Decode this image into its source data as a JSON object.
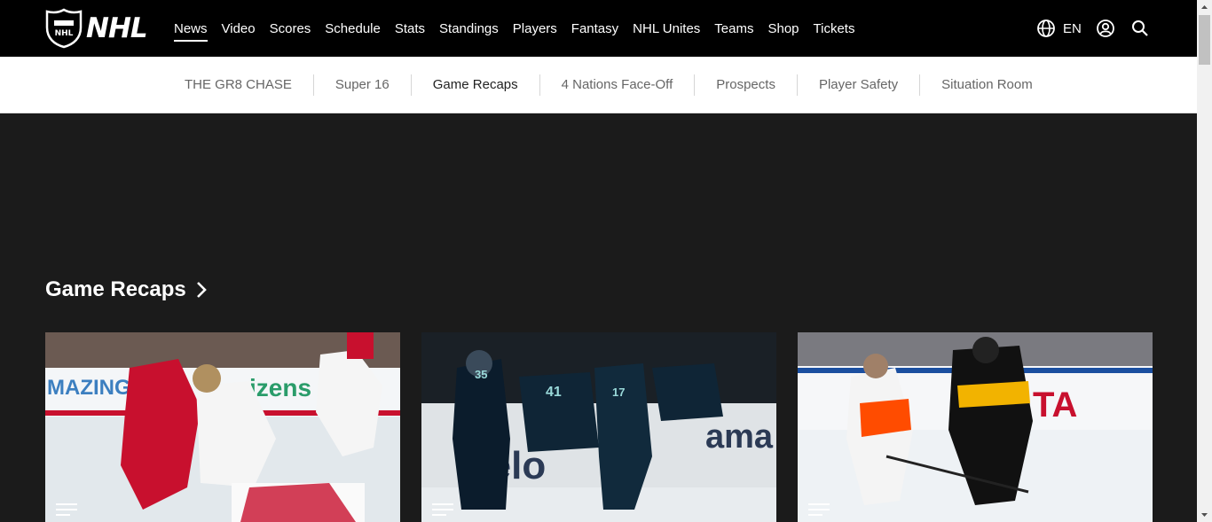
{
  "brand": {
    "logo_text": "NHL"
  },
  "nav": {
    "items": [
      {
        "label": "News"
      },
      {
        "label": "Video"
      },
      {
        "label": "Scores"
      },
      {
        "label": "Schedule"
      },
      {
        "label": "Stats"
      },
      {
        "label": "Standings"
      },
      {
        "label": "Players"
      },
      {
        "label": "Fantasy"
      },
      {
        "label": "NHL Unites"
      },
      {
        "label": "Teams"
      },
      {
        "label": "Shop"
      },
      {
        "label": "Tickets"
      }
    ],
    "active": "News"
  },
  "tools": {
    "language": "EN",
    "icons": [
      "globe-icon",
      "account-icon",
      "search-icon"
    ]
  },
  "subnav": {
    "items": [
      {
        "label": "THE GR8 CHASE"
      },
      {
        "label": "Super 16"
      },
      {
        "label": "Game Recaps"
      },
      {
        "label": "4 Nations Face-Off"
      },
      {
        "label": "Prospects"
      },
      {
        "label": "Player Safety"
      },
      {
        "label": "Situation Room"
      }
    ],
    "active": "Game Recaps"
  },
  "section": {
    "title": "Game Recaps"
  },
  "cards": [
    {
      "team_colors": [
        "#c8102e",
        "#ffffff"
      ],
      "icon": "article-icon"
    },
    {
      "team_colors": [
        "#001628",
        "#99d9d9"
      ],
      "icon": "article-icon"
    },
    {
      "team_colors": [
        "#041e42",
        "#ff4c00"
      ],
      "icon": "article-icon"
    }
  ],
  "colors": {
    "topbar": "#000000",
    "page_bg": "#1b1b1b",
    "subnav_bg": "#ffffff"
  }
}
